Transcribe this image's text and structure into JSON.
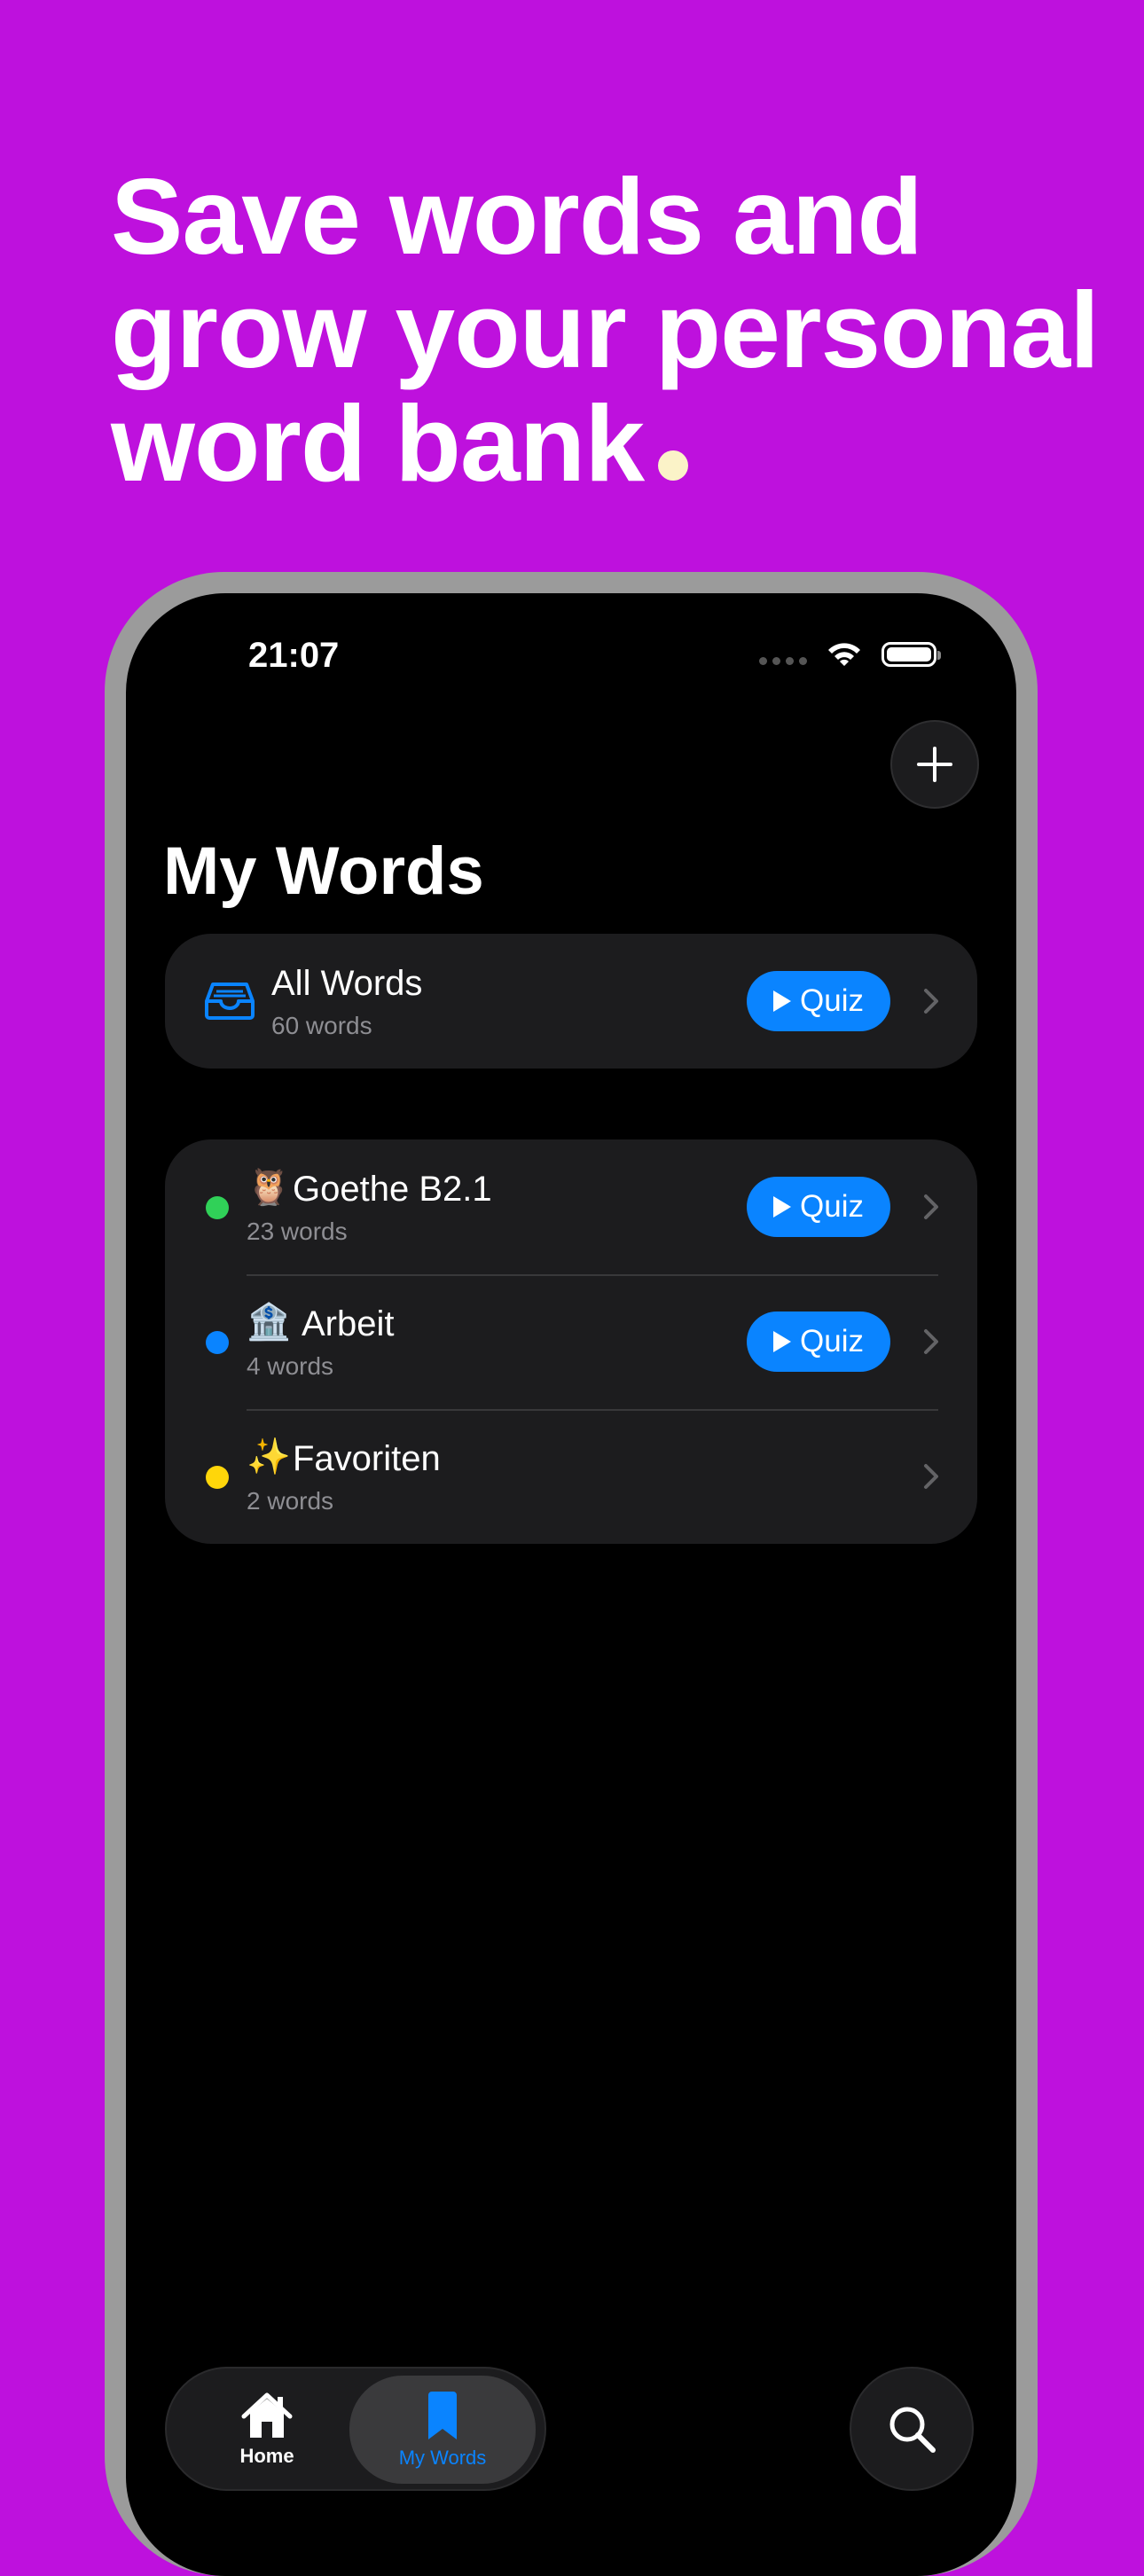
{
  "headline": {
    "line1": "Save words and",
    "line2": "grow your personal",
    "line3": "word bank"
  },
  "status_bar": {
    "time": "21:07"
  },
  "page": {
    "title": "My Words"
  },
  "all_words": {
    "title": "All Words",
    "count": "60 words",
    "quiz_label": "Quiz"
  },
  "lists": [
    {
      "emoji": "🦉",
      "name": "Goethe B2.1",
      "count": "23 words",
      "quiz_label": "Quiz",
      "dot_color": "#30D158"
    },
    {
      "emoji": "🏦",
      "name": "Arbeit",
      "count": "4 words",
      "quiz_label": "Quiz",
      "dot_color": "#0A84FF"
    },
    {
      "emoji": "✨",
      "name": "Favoriten",
      "count": "2 words",
      "dot_color": "#FFD60A"
    }
  ],
  "tabbar": {
    "home_label": "Home",
    "mywords_label": "My Words"
  },
  "colors": {
    "background": "#BE11DD",
    "accent": "#0A84FF",
    "headline_dot": "#FBF3C8"
  }
}
